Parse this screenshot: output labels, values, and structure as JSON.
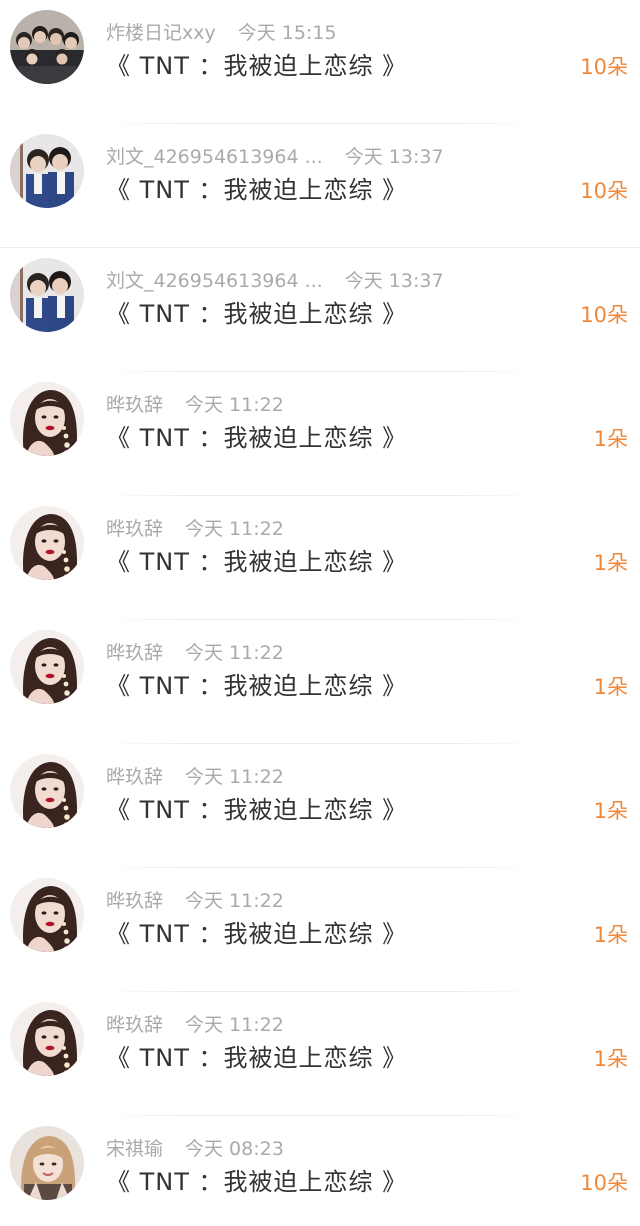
{
  "accent_color": "#f0883a",
  "rows": [
    {
      "name": "炸楼日记xxy",
      "time": "今天 15:15",
      "title": "《 TNT ：我被迫上恋综 》",
      "count": "10朵",
      "avatar": "group-photo"
    },
    {
      "name": "刘文_426954613964 ...",
      "time": "今天 13:37",
      "title": "《 TNT ：我被迫上恋综 》",
      "count": "10朵",
      "avatar": "school-uniform-duo"
    },
    {
      "name": "刘文_426954613964 ...",
      "time": "今天 13:37",
      "title": "《 TNT ：我被迫上恋综 》",
      "count": "10朵",
      "avatar": "school-uniform-duo"
    },
    {
      "name": "晔玖辞",
      "time": "今天 11:22",
      "title": "《 TNT ：我被迫上恋综 》",
      "count": "1朵",
      "avatar": "portrait-red-lips"
    },
    {
      "name": "晔玖辞",
      "time": "今天 11:22",
      "title": "《 TNT ：我被迫上恋综 》",
      "count": "1朵",
      "avatar": "portrait-red-lips"
    },
    {
      "name": "晔玖辞",
      "time": "今天 11:22",
      "title": "《 TNT ：我被迫上恋综 》",
      "count": "1朵",
      "avatar": "portrait-red-lips"
    },
    {
      "name": "晔玖辞",
      "time": "今天 11:22",
      "title": "《 TNT ：我被迫上恋综 》",
      "count": "1朵",
      "avatar": "portrait-red-lips"
    },
    {
      "name": "晔玖辞",
      "time": "今天 11:22",
      "title": "《 TNT ：我被迫上恋综 》",
      "count": "1朵",
      "avatar": "portrait-red-lips"
    },
    {
      "name": "晔玖辞",
      "time": "今天 11:22",
      "title": "《 TNT ：我被迫上恋综 》",
      "count": "1朵",
      "avatar": "portrait-red-lips"
    },
    {
      "name": "宋祺瑜",
      "time": "今天 08:23",
      "title": "《 TNT ：我被迫上恋综 》",
      "count": "10朵",
      "avatar": "portrait-blonde"
    }
  ]
}
